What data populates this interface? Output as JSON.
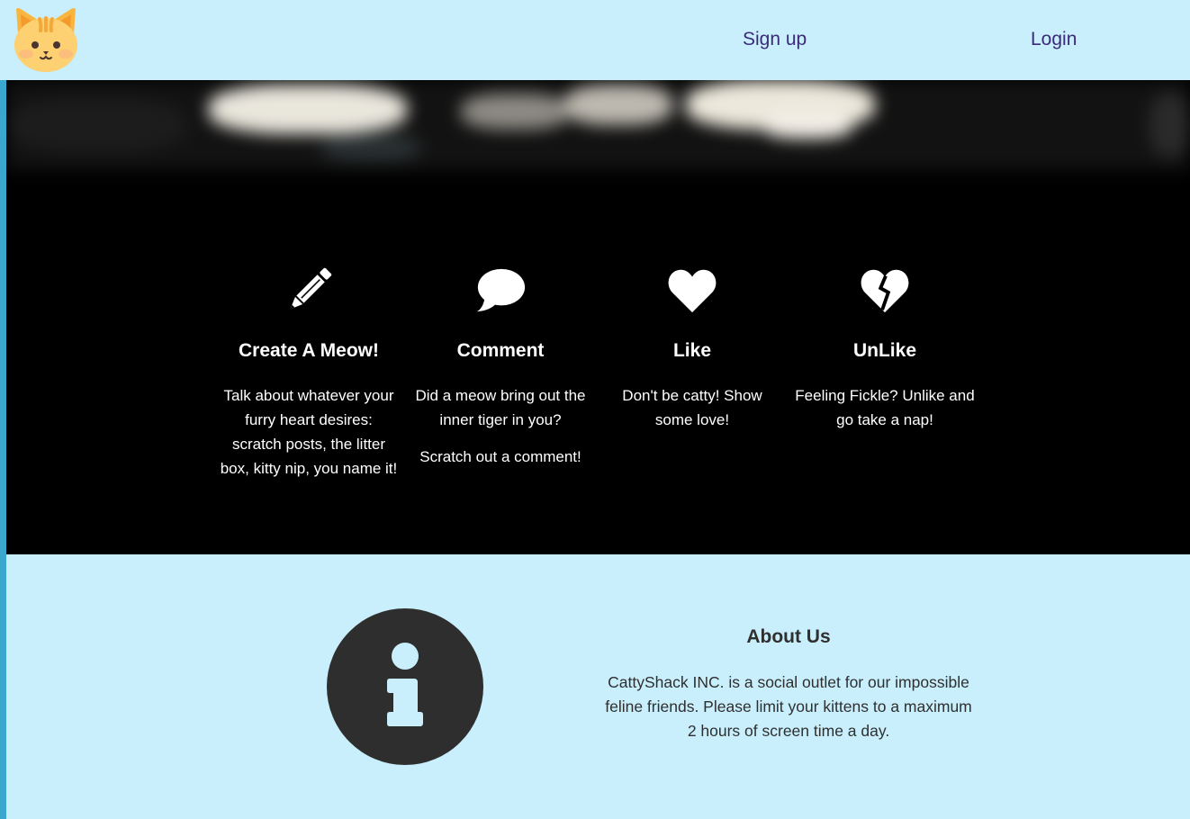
{
  "nav": {
    "logo_icon": "cat-face-icon",
    "signup_label": "Sign up",
    "login_label": "Login",
    "link_color": "#3b2a7a",
    "background_color": "#c9effc"
  },
  "features": {
    "background_color": "#000000",
    "items": [
      {
        "icon": "pencil-icon",
        "title": "Create A Meow!",
        "paragraphs": [
          "Talk about whatever your furry heart desires: scratch posts, the litter box, kitty nip, you name it!"
        ]
      },
      {
        "icon": "comment-icon",
        "title": "Comment",
        "paragraphs": [
          "Did a meow bring out the inner tiger in you?",
          "Scratch out a comment!"
        ]
      },
      {
        "icon": "heart-icon",
        "title": "Like",
        "paragraphs": [
          "Don't be catty! Show some love!"
        ]
      },
      {
        "icon": "broken-heart-icon",
        "title": "UnLike",
        "paragraphs": [
          "Feeling Fickle? Unlike and go take a nap!"
        ]
      }
    ]
  },
  "about": {
    "icon": "info-circle-icon",
    "title": "About Us",
    "text": "CattyShack INC. is a social outlet for our impossible feline friends. Please limit your kittens to a maximum 2 hours of screen time a day."
  }
}
